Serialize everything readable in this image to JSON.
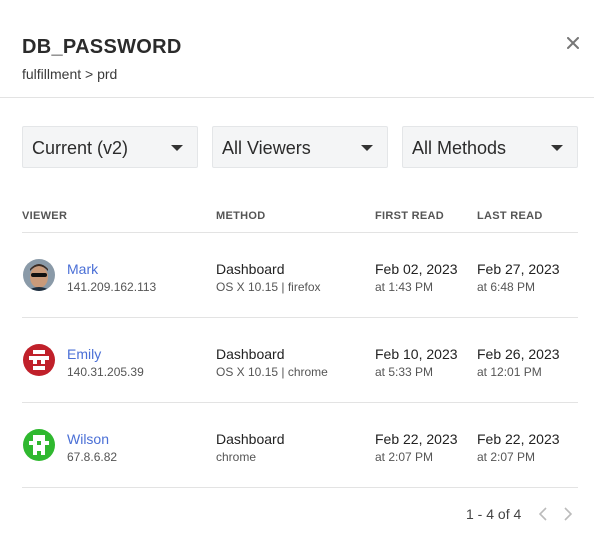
{
  "dialog": {
    "title": "DB_PASSWORD",
    "breadcrumb": "fulfillment > prd"
  },
  "filters": {
    "version": "Current (v2)",
    "viewers": "All Viewers",
    "methods": "All Methods"
  },
  "table": {
    "columns": [
      "VIEWER",
      "METHOD",
      "FIRST READ",
      "LAST READ"
    ],
    "rows": [
      {
        "name": "Mark",
        "ip": "141.209.162.113",
        "method": "Dashboard",
        "method_detail": "OS X 10.15 | firefox",
        "first_date": "Feb 02, 2023",
        "first_time": "at 1:43 PM",
        "last_date": "Feb 27, 2023",
        "last_time": "at 6:48 PM",
        "avatar": "photo-avatar"
      },
      {
        "name": "Emily",
        "ip": "140.31.205.39",
        "method": "Dashboard",
        "method_detail": "OS X 10.15 | chrome",
        "first_date": "Feb 10, 2023",
        "first_time": "at 5:33 PM",
        "last_date": "Feb 26, 2023",
        "last_time": "at 12:01 PM",
        "avatar": "identicon-red"
      },
      {
        "name": "Wilson",
        "ip": "67.8.6.82",
        "method": "Dashboard",
        "method_detail": "chrome",
        "first_date": "Feb 22, 2023",
        "first_time": "at 2:07 PM",
        "last_date": "Feb 22, 2023",
        "last_time": "at 2:07 PM",
        "avatar": "identicon-green"
      }
    ]
  },
  "pagination": {
    "summary": "1 - 4 of 4"
  },
  "colors": {
    "link": "#4a6fd6",
    "identicon_red": "#c0202a",
    "identicon_green": "#2fb82f"
  }
}
